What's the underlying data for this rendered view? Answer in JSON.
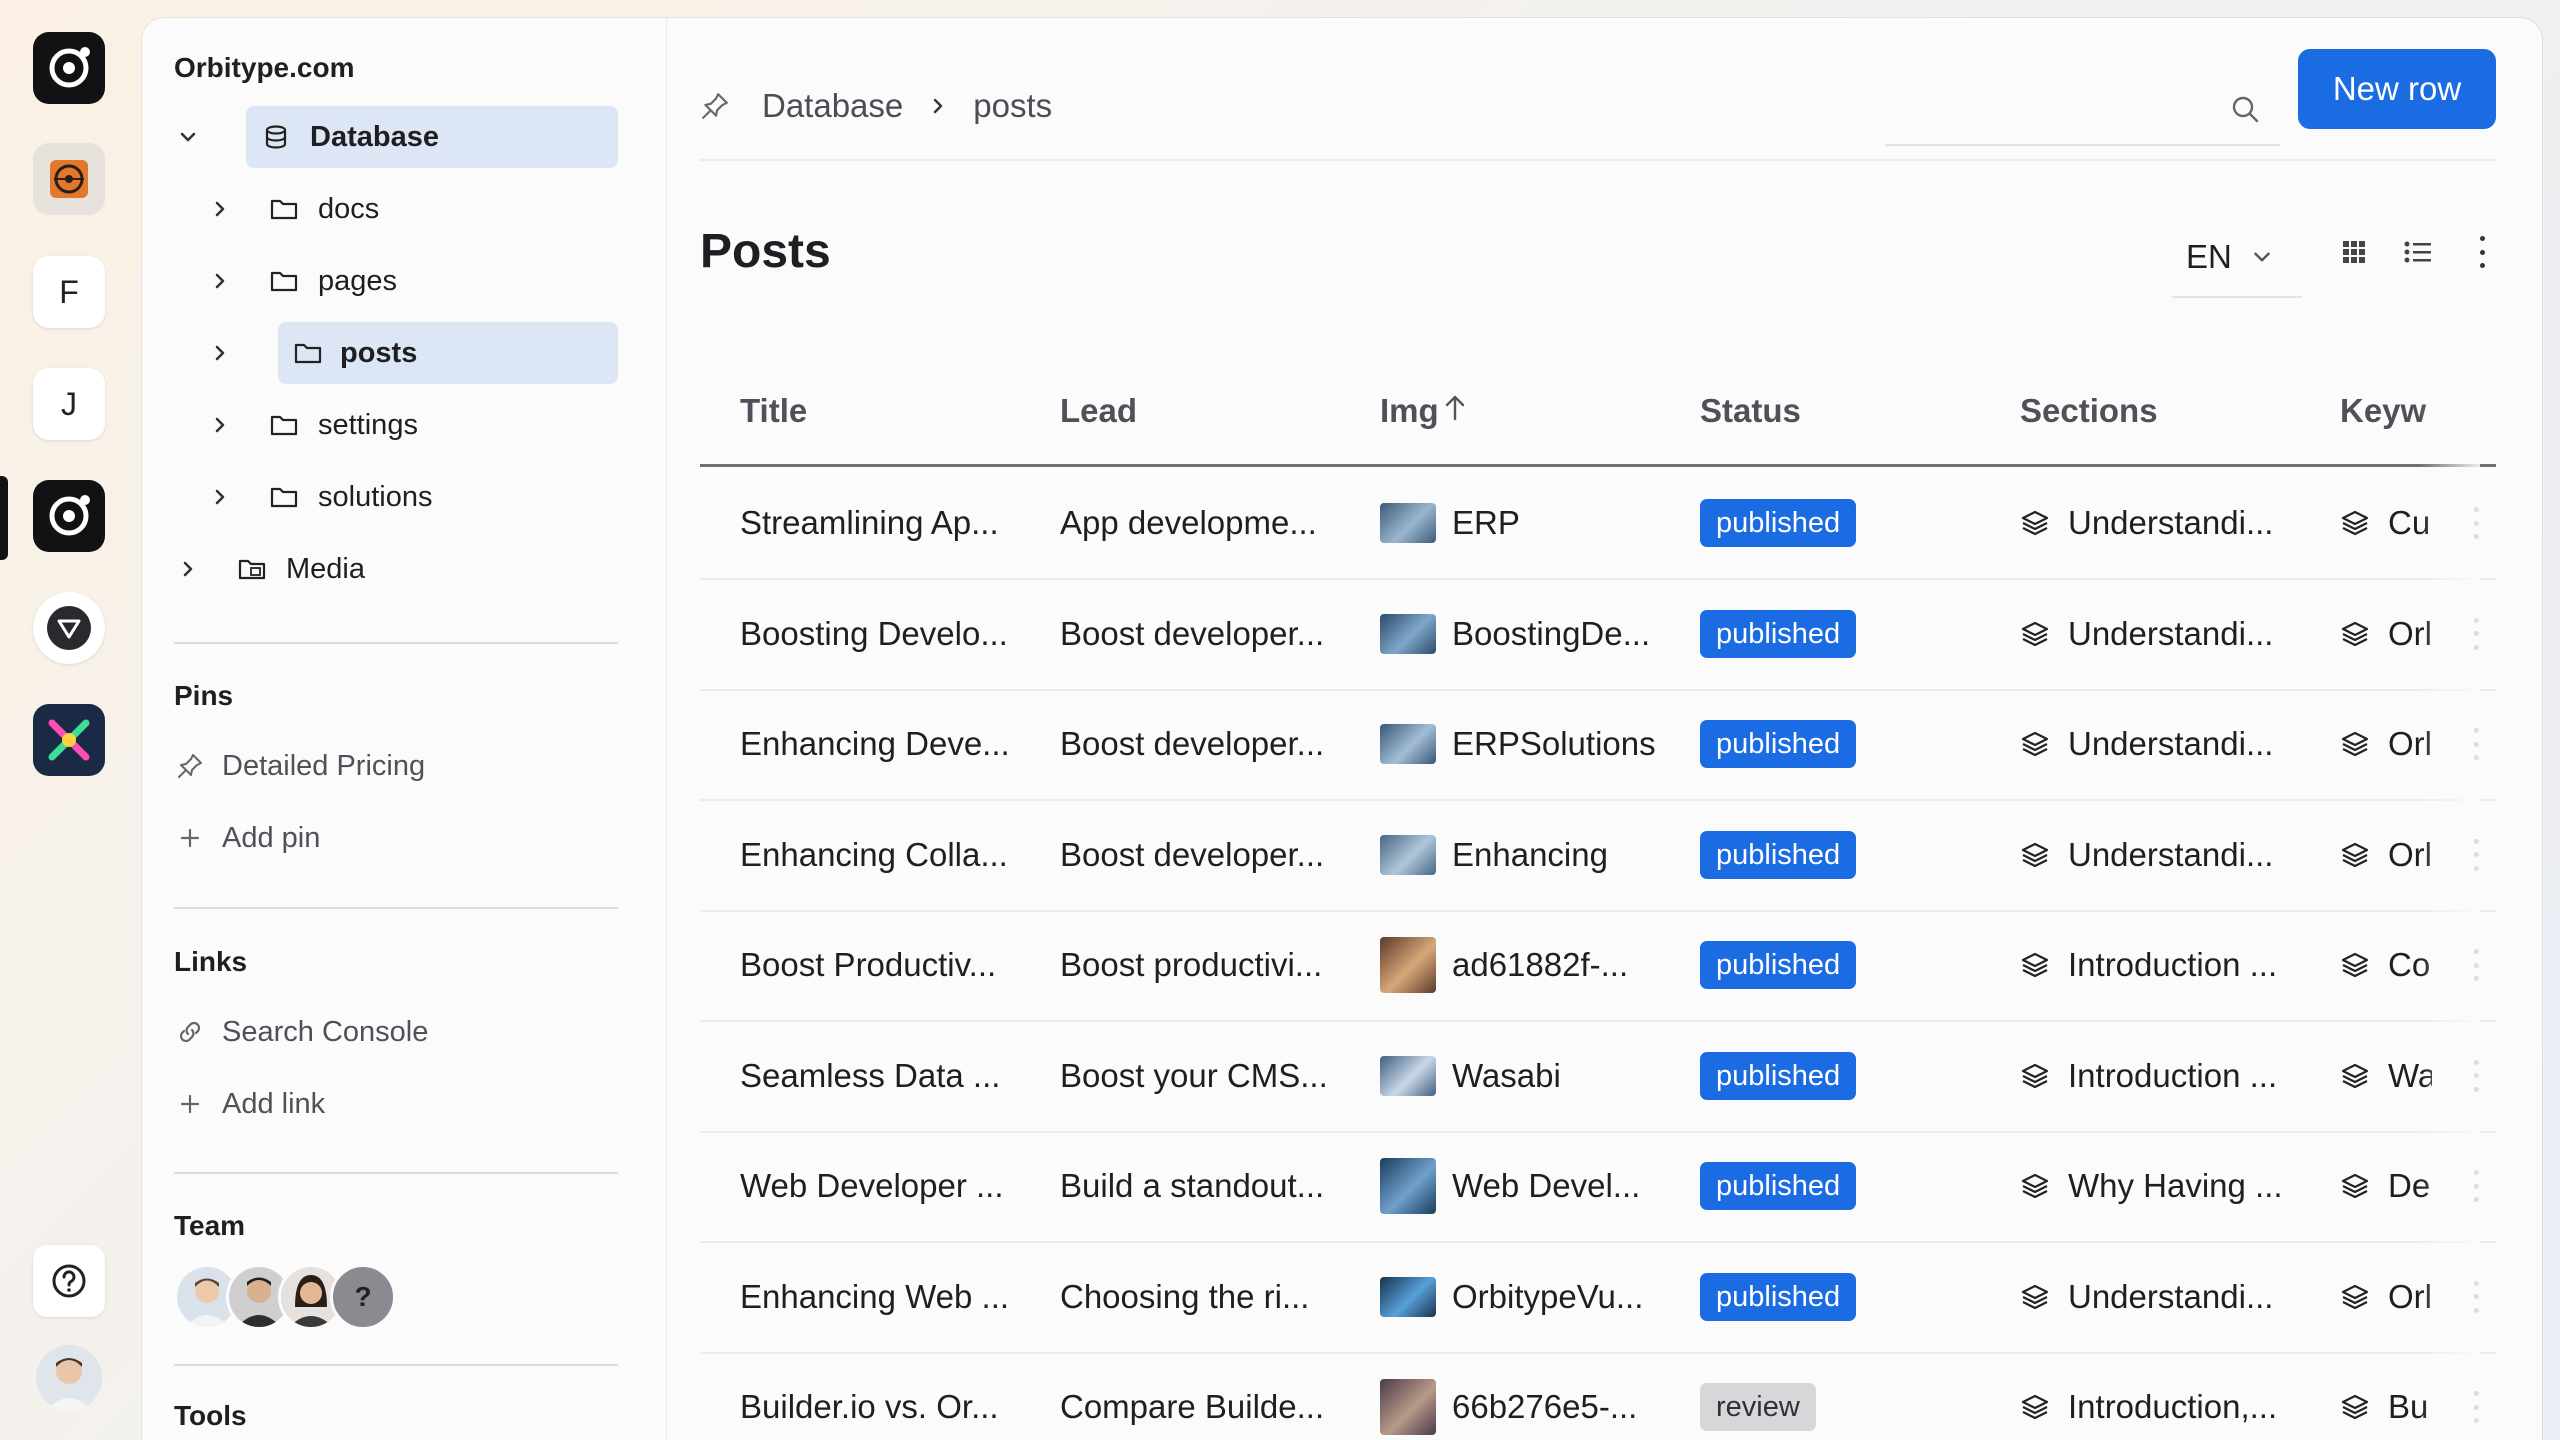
{
  "rail": {
    "letter_f": "F",
    "letter_j": "J"
  },
  "sidebar": {
    "site_name": "Orbitype.com",
    "tree": {
      "database": "Database",
      "docs": "docs",
      "pages": "pages",
      "posts": "posts",
      "settings": "settings",
      "solutions": "solutions",
      "media": "Media"
    },
    "pins": {
      "heading": "Pins",
      "items": [
        "Detailed Pricing"
      ],
      "add": "Add pin"
    },
    "links": {
      "heading": "Links",
      "items": [
        "Search Console"
      ],
      "add": "Add link"
    },
    "team": {
      "heading": "Team",
      "unknown_member": "?"
    },
    "tools": {
      "heading": "Tools"
    }
  },
  "header": {
    "breadcrumb": [
      "Database",
      "posts"
    ],
    "search_placeholder": "",
    "new_row_label": "New row"
  },
  "page": {
    "title": "Posts",
    "language": "EN"
  },
  "table": {
    "columns": [
      "Title",
      "Lead",
      "Img",
      "Status",
      "Sections",
      "Keyw"
    ],
    "rows": [
      {
        "title": "Streamlining Ap...",
        "lead": "App developme...",
        "img": "ERP",
        "status": "published",
        "sections": "Understandi...",
        "keywords": "Cu"
      },
      {
        "title": "Boosting Develo...",
        "lead": "Boost developer...",
        "img": "BoostingDe...",
        "status": "published",
        "sections": "Understandi...",
        "keywords": "Orl"
      },
      {
        "title": "Enhancing Deve...",
        "lead": "Boost developer...",
        "img": "ERPSolutions",
        "status": "published",
        "sections": "Understandi...",
        "keywords": "Orl"
      },
      {
        "title": "Enhancing Colla...",
        "lead": "Boost developer...",
        "img": "Enhancing",
        "status": "published",
        "sections": "Understandi...",
        "keywords": "Orl"
      },
      {
        "title": "Boost Productiv...",
        "lead": "Boost productivi...",
        "img": "ad61882f-...",
        "status": "published",
        "sections": "Introduction ...",
        "keywords": "Co"
      },
      {
        "title": "Seamless Data ...",
        "lead": "Boost your CMS...",
        "img": "Wasabi",
        "status": "published",
        "sections": "Introduction ...",
        "keywords": "Wa"
      },
      {
        "title": "Web Developer ...",
        "lead": "Build a standout...",
        "img": "Web Devel...",
        "status": "published",
        "sections": "Why Having ...",
        "keywords": "De"
      },
      {
        "title": "Enhancing Web ...",
        "lead": "Choosing the ri...",
        "img": "OrbitypeVu...",
        "status": "published",
        "sections": "Understandi...",
        "keywords": "Orl"
      },
      {
        "title": "Builder.io vs. Or...",
        "lead": "Compare Builde...",
        "img": "66b276e5-...",
        "status": "review",
        "sections": "Introduction,...",
        "keywords": "Bu"
      }
    ]
  },
  "colors": {
    "accent": "#1b6ce3",
    "selected_bg": "#dde6f4",
    "review_badge": "#d7d7da"
  }
}
